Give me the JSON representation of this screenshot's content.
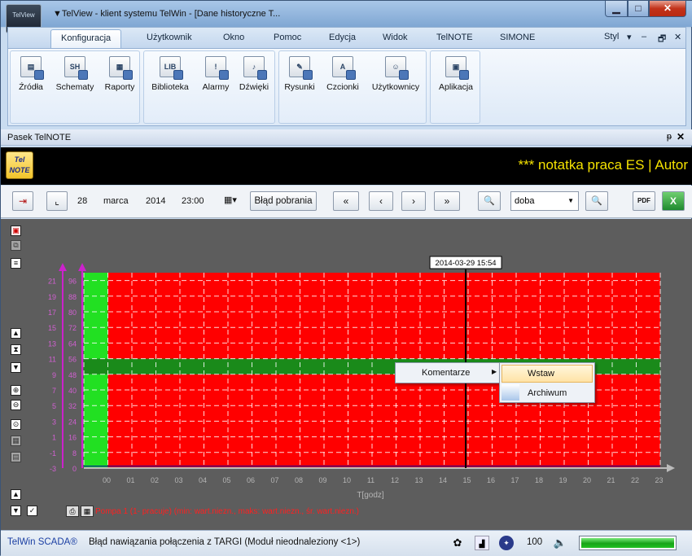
{
  "window": {
    "title": "▼TelView - klient systemu TelWin - [Dane historyczne T...",
    "app_icon_text": "TelView"
  },
  "menu": {
    "items": [
      "Konfiguracja",
      "Użytkownik",
      "Okno",
      "Pomoc",
      "Edycja",
      "Widok",
      "TelNOTE",
      "SIMONE"
    ],
    "active": "Konfiguracja",
    "style_label": "Styl",
    "style_arrow": "▾",
    "mdi_min": "‒",
    "mdi_restore": "🗗",
    "mdi_close": "✕"
  },
  "ribbon": {
    "buttons": [
      {
        "label": "Źródła",
        "icon": "sources-icon",
        "glyph": "▤"
      },
      {
        "label": "Schematy",
        "icon": "schematics-icon",
        "glyph": "SH"
      },
      {
        "label": "Raporty",
        "icon": "reports-icon",
        "glyph": "▦"
      },
      {
        "label": "Biblioteka",
        "icon": "library-icon",
        "glyph": "LIB"
      },
      {
        "label": "Alarmy",
        "icon": "alarms-icon",
        "glyph": "!"
      },
      {
        "label": "Dźwięki",
        "icon": "sounds-icon",
        "glyph": "♪"
      },
      {
        "label": "Rysunki",
        "icon": "drawings-icon",
        "glyph": "✎"
      },
      {
        "label": "Czcionki",
        "icon": "fonts-icon",
        "glyph": "A"
      },
      {
        "label": "Użytkownicy",
        "icon": "users-icon",
        "glyph": "☺"
      },
      {
        "label": "Aplikacja",
        "icon": "application-icon",
        "glyph": "▣"
      }
    ]
  },
  "panel": {
    "title": "Pasek TelNOTE",
    "pin": "ᵽ",
    "close": "✕"
  },
  "telnote": {
    "logo_text": "Tel NOTE",
    "ticker": "***  notatka praca ES | Autor"
  },
  "toolbar": {
    "exit_icon": "exit-icon",
    "chart_icon": "chart-type-icon",
    "day": "28",
    "month": "marca",
    "year": "2014",
    "time": "23:00",
    "calendar_glyph": "▦▾",
    "error_button": "Błąd pobrania",
    "first": "«",
    "prev": "‹",
    "next": "›",
    "last": "»",
    "zoom_in": "🔍",
    "range": "doba",
    "range_arrow": "▼",
    "zoom_out": "🔍",
    "pdf": "PDF",
    "excel": "X"
  },
  "colors": {
    "alarm_red": "#ff0000",
    "ok_green": "#1a8a1a",
    "bright_green": "#22e022",
    "axis_magenta": "#cc22cc",
    "plot_bg": "#5d5d5d"
  },
  "cursor_label": "2014-03-29 15:54",
  "legend": {
    "text": "Pompa 1 (1- pracuje)  (min: wart.niezn., maks: wart.niezn., śr. wart.niezn.)"
  },
  "context_menu": {
    "parent": "Komentarze",
    "submenu": [
      "Wstaw",
      "Archiwum"
    ],
    "highlighted": "Wstaw"
  },
  "chart_data": {
    "type": "area",
    "xlabel": "T[godz]",
    "x": [
      "00",
      "01",
      "02",
      "03",
      "04",
      "05",
      "06",
      "07",
      "08",
      "09",
      "10",
      "11",
      "12",
      "13",
      "14",
      "15",
      "16",
      "17",
      "18",
      "19",
      "20",
      "21",
      "22",
      "23"
    ],
    "y_left_ticks": [
      "21",
      "19",
      "17",
      "15",
      "13",
      "11",
      "9",
      "7",
      "5",
      "3",
      "1",
      "-1",
      "-3"
    ],
    "y_right_ticks": [
      "96",
      "88",
      "80",
      "72",
      "64",
      "56",
      "48",
      "40",
      "32",
      "24",
      "16",
      "8",
      "0"
    ],
    "series": [
      {
        "values": [
          1,
          1,
          1,
          1,
          1,
          1,
          1,
          1,
          1,
          1,
          1,
          1,
          1,
          1,
          1,
          1,
          1,
          1,
          1,
          1,
          1,
          1,
          1,
          1
        ]
      }
    ],
    "cursor_x": "2014-03-29 15:54",
    "states": [
      {
        "from": 0,
        "to": 1,
        "state": "ok",
        "color": "#22e022"
      },
      {
        "from": 1,
        "to": 24,
        "state": "alarm",
        "color": "#ff0000"
      }
    ],
    "band": {
      "from": 56,
      "to": 48,
      "color": "#1a8a1a"
    }
  },
  "status": {
    "brand": "TelWin SCADA®",
    "message": "Błąd nawiązania połączenia z TARGI (Moduł nieodnaleziony <1>)",
    "zoom": "100",
    "progress": 1.0
  }
}
